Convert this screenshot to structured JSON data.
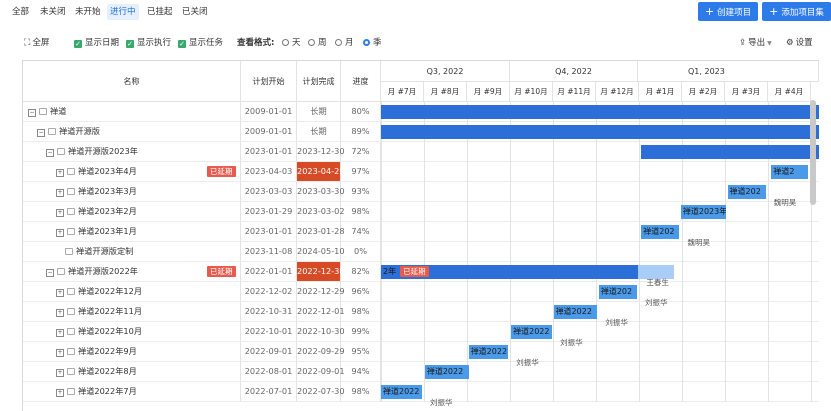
{
  "filter_tabs": [
    "全部",
    "未关闭",
    "未开始",
    "进行中",
    "已挂起",
    "已关闭"
  ],
  "active_tab": "进行中",
  "buttons": {
    "create": "创建项目",
    "add_set": "添加项目集"
  },
  "options": {
    "fullscreen": "全屏",
    "show_date": "显示日期",
    "show_exec": "显示执行",
    "show_task": "显示任务",
    "view_format_label": "查看格式:",
    "formats": [
      "天",
      "周",
      "月",
      "季"
    ],
    "selected_format": "季",
    "export": "导出",
    "settings": "设置"
  },
  "columns": {
    "name": "名称",
    "start": "计划开始",
    "end": "计划完成",
    "progress": "进度"
  },
  "quarters": [
    "Q3, 2022",
    "Q4, 2022",
    "Q1, 2023"
  ],
  "months": [
    "月 #7月",
    "月 #8月",
    "月 #9月",
    "月 #10月",
    "月 #11月",
    "月 #12月",
    "月 #1月",
    "月 #2月",
    "月 #3月",
    "月 #4月"
  ],
  "overdue_label": "已延期",
  "rows": [
    {
      "name": "禅道",
      "level": 0,
      "type": "group",
      "start": "2009-01-01",
      "end": "长期",
      "progress": "80%"
    },
    {
      "name": "禅道开源版",
      "level": 1,
      "type": "group",
      "start": "2009-01-01",
      "end": "长期",
      "progress": "89%"
    },
    {
      "name": "禅道开源版2023年",
      "level": 2,
      "type": "group",
      "start": "2023-01-01",
      "end": "2023-12-30",
      "progress": "72%"
    },
    {
      "name": "禅道2023年4月",
      "level": 3,
      "type": "item",
      "start": "2023-04-03",
      "end": "2023-04-29",
      "progress": "97%",
      "overdue": true
    },
    {
      "name": "禅道2023年3月",
      "level": 3,
      "type": "item",
      "start": "2023-03-03",
      "end": "2023-03-30",
      "progress": "93%"
    },
    {
      "name": "禅道2023年2月",
      "level": 3,
      "type": "item",
      "start": "2023-01-29",
      "end": "2023-03-02",
      "progress": "98%"
    },
    {
      "name": "禅道2023年1月",
      "level": 3,
      "type": "item",
      "start": "2023-01-01",
      "end": "2023-01-28",
      "progress": "74%"
    },
    {
      "name": "禅道开源版定制",
      "level": 3,
      "type": "doc",
      "start": "2023-11-08",
      "end": "2024-05-10",
      "progress": "0%"
    },
    {
      "name": "禅道开源版2022年",
      "level": 2,
      "type": "group",
      "start": "2022-01-01",
      "end": "2022-12-30",
      "progress": "82%",
      "overdue": true
    },
    {
      "name": "禅道2022年12月",
      "level": 3,
      "type": "item",
      "start": "2022-12-02",
      "end": "2022-12-29",
      "progress": "96%"
    },
    {
      "name": "禅道2022年11月",
      "level": 3,
      "type": "item",
      "start": "2022-10-31",
      "end": "2022-12-01",
      "progress": "98%"
    },
    {
      "name": "禅道2022年10月",
      "level": 3,
      "type": "item",
      "start": "2022-10-01",
      "end": "2022-10-30",
      "progress": "99%"
    },
    {
      "name": "禅道2022年9月",
      "level": 3,
      "type": "item",
      "start": "2022-09-01",
      "end": "2022-09-29",
      "progress": "95%"
    },
    {
      "name": "禅道2022年8月",
      "level": 3,
      "type": "item",
      "start": "2022-08-01",
      "end": "2022-09-01",
      "progress": "94%"
    },
    {
      "name": "禅道2022年7月",
      "level": 3,
      "type": "item",
      "start": "2022-07-01",
      "end": "2022-07-30",
      "progress": "98%"
    }
  ],
  "gantt": {
    "bars": [
      {
        "row": 0,
        "label": "",
        "style": "dark"
      },
      {
        "row": 1,
        "label": "",
        "style": "dark"
      },
      {
        "row": 2,
        "label": "",
        "style": "dark"
      },
      {
        "row": 3,
        "label": "禅道2",
        "style": "mid",
        "owner": ""
      },
      {
        "row": 4,
        "label": "禅道202",
        "style": "mid",
        "owner": "魏明昊"
      },
      {
        "row": 5,
        "label": "禅道2023年",
        "style": "mid",
        "owner": ""
      },
      {
        "row": 6,
        "label": "禅道202",
        "style": "mid",
        "owner": "魏明昊"
      },
      {
        "row": 8,
        "label": "2年",
        "style": "dark",
        "owner": "王春生",
        "overdue": true
      },
      {
        "row": 9,
        "label": "禅道202",
        "style": "mid",
        "owner": "刘振华"
      },
      {
        "row": 10,
        "label": "禅道2022",
        "style": "mid",
        "owner": "刘振华"
      },
      {
        "row": 11,
        "label": "禅道2022",
        "style": "mid",
        "owner": "刘振华"
      },
      {
        "row": 12,
        "label": "禅道2022",
        "style": "mid",
        "owner": "刘振华"
      },
      {
        "row": 13,
        "label": "禅道2022",
        "style": "mid",
        "owner": ""
      },
      {
        "row": 14,
        "label": "禅道2022",
        "style": "mid",
        "owner": "刘振华"
      }
    ]
  }
}
